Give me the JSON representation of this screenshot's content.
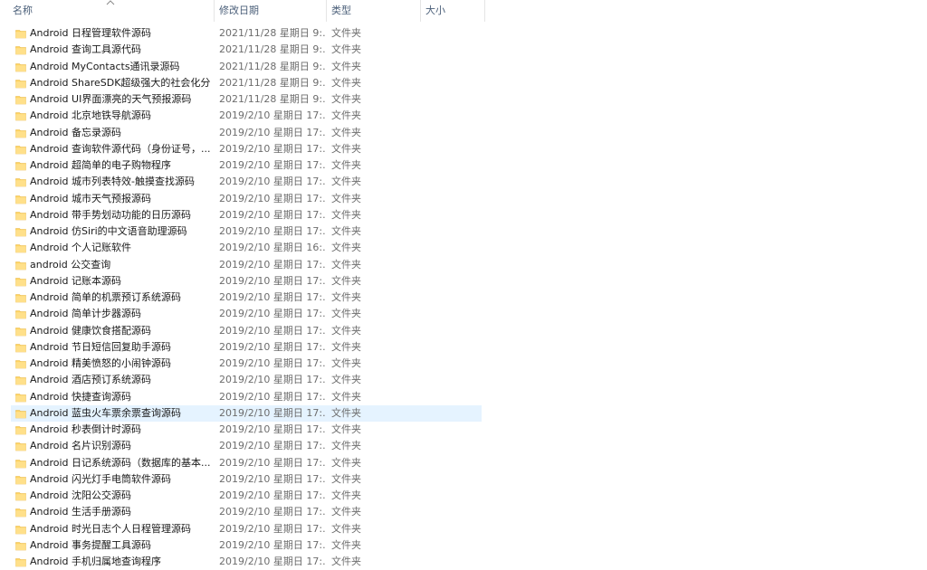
{
  "columns": {
    "name": "名称",
    "date": "修改日期",
    "type": "类型",
    "size": "大小"
  },
  "sort_icon": "sort-ascending-chevron-icon",
  "folder_icon": "folder-icon",
  "folder_color": "#ffd460",
  "hover_color": "#e5f3ff",
  "files": [
    {
      "name": "Android 日程管理软件源码",
      "date": "2021/11/28 星期日 9:...",
      "type": "文件夹"
    },
    {
      "name": "Android  查询工具源代码",
      "date": "2021/11/28 星期日 9:...",
      "type": "文件夹"
    },
    {
      "name": "Android MyContacts通讯录源码",
      "date": "2021/11/28 星期日 9:...",
      "type": "文件夹"
    },
    {
      "name": "Android ShareSDK超级强大的社会化分...",
      "date": "2021/11/28 星期日 9:...",
      "type": "文件夹"
    },
    {
      "name": "Android UI界面漂亮的天气预报源码",
      "date": "2021/11/28 星期日 9:...",
      "type": "文件夹"
    },
    {
      "name": "Android 北京地铁导航源码",
      "date": "2019/2/10 星期日 17:...",
      "type": "文件夹"
    },
    {
      "name": "Android 备忘录源码",
      "date": "2019/2/10 星期日 17:...",
      "type": "文件夹"
    },
    {
      "name": "Android 查询软件源代码（身份证号，...",
      "date": "2019/2/10 星期日 17:...",
      "type": "文件夹"
    },
    {
      "name": "Android 超简单的电子购物程序",
      "date": "2019/2/10 星期日 17:...",
      "type": "文件夹"
    },
    {
      "name": "Android 城市列表特效-触摸查找源码",
      "date": "2019/2/10 星期日 17:...",
      "type": "文件夹"
    },
    {
      "name": "Android 城市天气预报源码",
      "date": "2019/2/10 星期日 17:...",
      "type": "文件夹"
    },
    {
      "name": "Android 带手势划动功能的日历源码",
      "date": "2019/2/10 星期日 17:...",
      "type": "文件夹"
    },
    {
      "name": "Android 仿Siri的中文语音助理源码",
      "date": "2019/2/10 星期日 17:...",
      "type": "文件夹"
    },
    {
      "name": "Android 个人记账软件",
      "date": "2019/2/10 星期日 16:...",
      "type": "文件夹"
    },
    {
      "name": "android 公交查询",
      "date": "2019/2/10 星期日 17:...",
      "type": "文件夹"
    },
    {
      "name": "Android 记账本源码",
      "date": "2019/2/10 星期日 17:...",
      "type": "文件夹"
    },
    {
      "name": "Android 简单的机票预订系统源码",
      "date": "2019/2/10 星期日 17:...",
      "type": "文件夹"
    },
    {
      "name": "Android 简单计步器源码",
      "date": "2019/2/10 星期日 17:...",
      "type": "文件夹"
    },
    {
      "name": "Android 健康饮食搭配源码",
      "date": "2019/2/10 星期日 17:...",
      "type": "文件夹"
    },
    {
      "name": "Android 节日短信回复助手源码",
      "date": "2019/2/10 星期日 17:...",
      "type": "文件夹"
    },
    {
      "name": "Android 精美愤怒的小闹钟源码",
      "date": "2019/2/10 星期日 17:...",
      "type": "文件夹"
    },
    {
      "name": "Android 酒店预订系统源码",
      "date": "2019/2/10 星期日 17:...",
      "type": "文件夹"
    },
    {
      "name": "Android 快捷查询源码",
      "date": "2019/2/10 星期日 17:...",
      "type": "文件夹"
    },
    {
      "name": "Android 蓝虫火车票余票查询源码",
      "date": "2019/2/10 星期日 17:...",
      "type": "文件夹"
    },
    {
      "name": "Android 秒表倒计时源码",
      "date": "2019/2/10 星期日 17:...",
      "type": "文件夹"
    },
    {
      "name": "Android 名片识别源码",
      "date": "2019/2/10 星期日 17:...",
      "type": "文件夹"
    },
    {
      "name": "Android 日记系统源码（数据库的基本...",
      "date": "2019/2/10 星期日 17:...",
      "type": "文件夹"
    },
    {
      "name": "Android 闪光灯手电筒软件源码",
      "date": "2019/2/10 星期日 17:...",
      "type": "文件夹"
    },
    {
      "name": "Android 沈阳公交源码",
      "date": "2019/2/10 星期日 17:...",
      "type": "文件夹"
    },
    {
      "name": "Android 生活手册源码",
      "date": "2019/2/10 星期日 17:...",
      "type": "文件夹"
    },
    {
      "name": "Android 时光日志个人日程管理源码",
      "date": "2019/2/10 星期日 17:...",
      "type": "文件夹"
    },
    {
      "name": "Android 事务提醒工具源码",
      "date": "2019/2/10 星期日 17:...",
      "type": "文件夹"
    },
    {
      "name": "Android 手机归属地查询程序",
      "date": "2019/2/10 星期日 17:...",
      "type": "文件夹"
    }
  ]
}
